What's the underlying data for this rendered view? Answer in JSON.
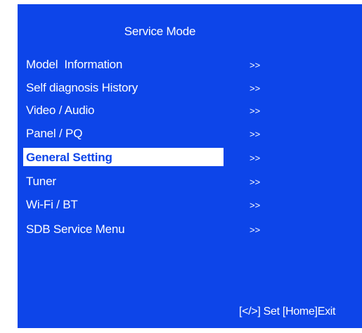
{
  "screen": {
    "title": "Service Mode",
    "background_color": "#0d45e9",
    "selected_color": "#ffffff",
    "menu": [
      {
        "label": "Model  Information",
        "arrow": ">>",
        "selected": false
      },
      {
        "label": "Self diagnosis History",
        "arrow": ">>",
        "selected": false
      },
      {
        "label": "Video / Audio",
        "arrow": ">>",
        "selected": false
      },
      {
        "label": "Panel / PQ",
        "arrow": ">>",
        "selected": false
      },
      {
        "label": "General Setting",
        "arrow": ">>",
        "selected": true
      },
      {
        "label": "Tuner",
        "arrow": ">>",
        "selected": false
      },
      {
        "label": "Wi-Fi / BT",
        "arrow": ">>",
        "selected": false
      },
      {
        "label": "SDB Service Menu",
        "arrow": ">>",
        "selected": false
      }
    ],
    "footer_hint": "[</>] Set [Home]Exit"
  }
}
